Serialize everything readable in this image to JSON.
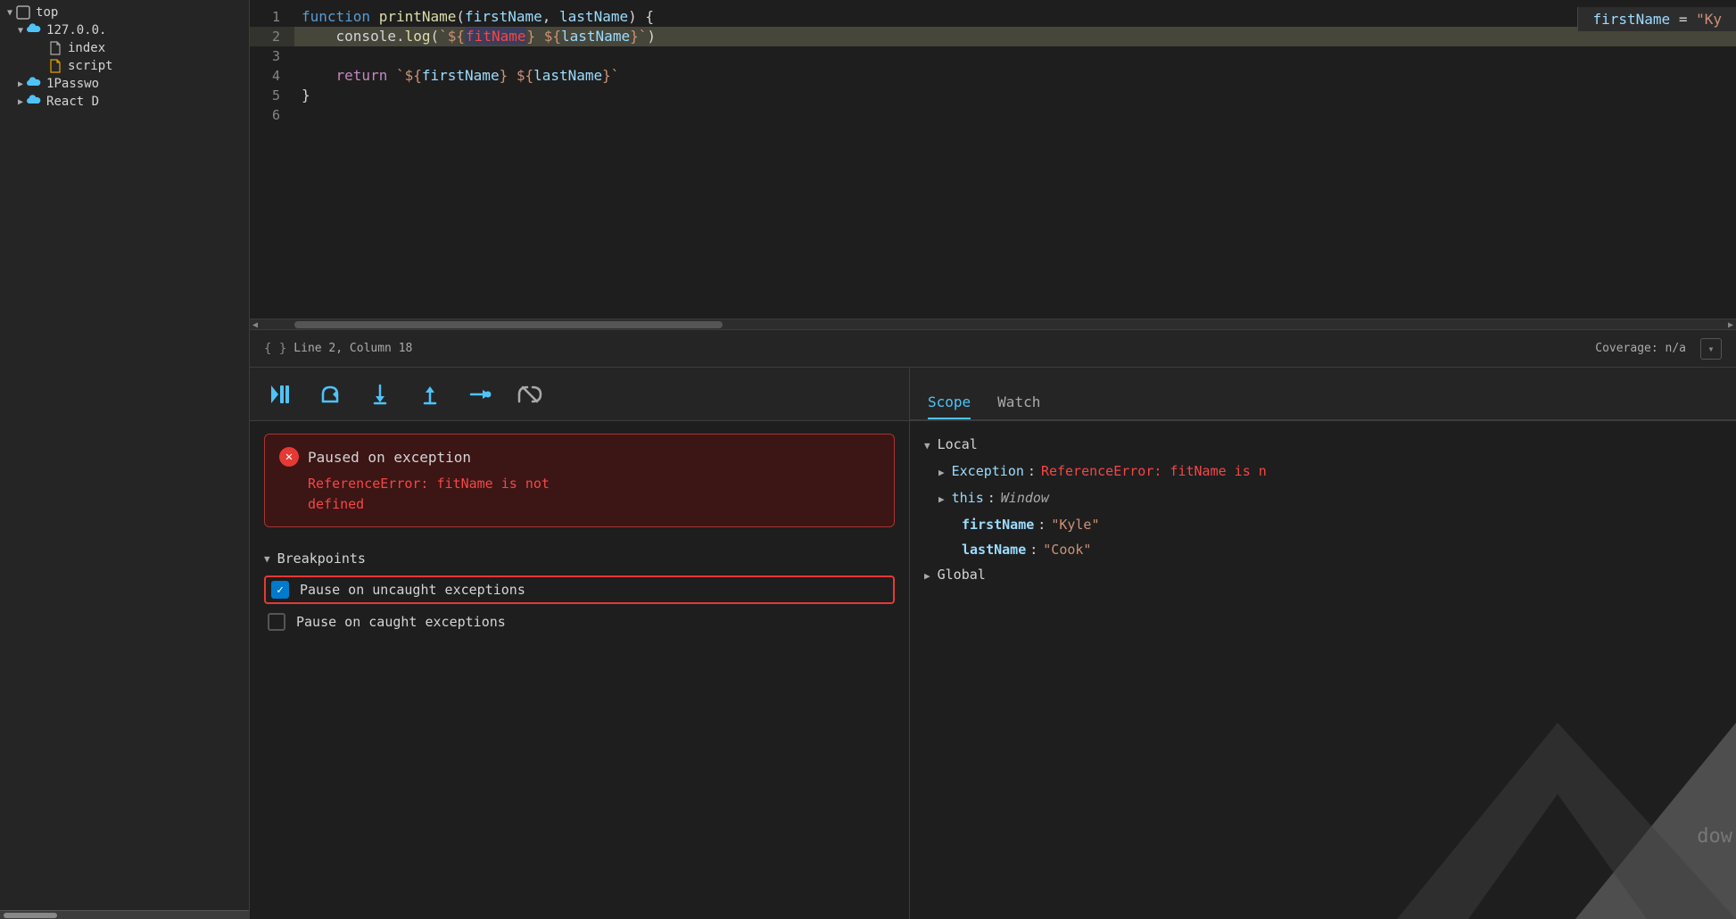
{
  "sidebar": {
    "items": [
      {
        "id": "top",
        "label": "top",
        "indent": 0,
        "arrow": "▼",
        "icon": "frame"
      },
      {
        "id": "127",
        "label": "127.0.0.",
        "indent": 1,
        "arrow": "▼",
        "icon": "cloud"
      },
      {
        "id": "index",
        "label": "index",
        "indent": 2,
        "arrow": "",
        "icon": "file"
      },
      {
        "id": "script",
        "label": "script",
        "indent": 2,
        "arrow": "",
        "icon": "file-orange"
      },
      {
        "id": "1password",
        "label": "1Passwo",
        "indent": 1,
        "arrow": "▶",
        "icon": "cloud"
      },
      {
        "id": "react",
        "label": "React D",
        "indent": 1,
        "arrow": "▶",
        "icon": "cloud"
      }
    ]
  },
  "editor": {
    "lines": [
      {
        "num": 1,
        "content": "function printName(firstName, lastName) {",
        "highlighted": false
      },
      {
        "num": 2,
        "content": "    console.log(`${fitName} ${lastName}`)",
        "highlighted": true
      },
      {
        "num": 3,
        "content": "",
        "highlighted": false
      },
      {
        "num": 4,
        "content": "    return `${firstName} ${lastName}`",
        "highlighted": false
      },
      {
        "num": 5,
        "content": "}",
        "highlighted": false
      },
      {
        "num": 6,
        "content": "",
        "highlighted": false
      }
    ],
    "right_preview": "firstName = \"Ky",
    "status": {
      "position": "Line 2, Column 18",
      "coverage": "Coverage: n/a"
    }
  },
  "toolbar": {
    "buttons": [
      {
        "id": "resume",
        "icon": "▶▌",
        "label": "Resume"
      },
      {
        "id": "step-over",
        "icon": "↺",
        "label": "Step over"
      },
      {
        "id": "step-into",
        "icon": "↓",
        "label": "Step into"
      },
      {
        "id": "step-out",
        "icon": "↑",
        "label": "Step out"
      },
      {
        "id": "step-next",
        "icon": "→•",
        "label": "Step"
      },
      {
        "id": "deactivate",
        "icon": "⇢",
        "label": "Deactivate"
      }
    ]
  },
  "exception": {
    "title": "Paused on exception",
    "message": "ReferenceError: fitName is not\ndefined"
  },
  "breakpoints": {
    "title": "Breakpoints",
    "items": [
      {
        "id": "uncaught",
        "checked": true,
        "label": "Pause on uncaught exceptions",
        "highlighted": true
      },
      {
        "id": "caught",
        "checked": false,
        "label": "Pause on caught exceptions",
        "highlighted": false
      }
    ]
  },
  "scope": {
    "tabs": [
      {
        "id": "scope",
        "label": "Scope",
        "active": true
      },
      {
        "id": "watch",
        "label": "Watch",
        "active": false
      }
    ],
    "tree": [
      {
        "id": "local",
        "label": "Local",
        "arrow": "▼",
        "indent": 0,
        "key": "",
        "colon": "",
        "value": ""
      },
      {
        "id": "exception-item",
        "label": "Exception: ReferenceError: fitName is n",
        "arrow": "▶",
        "indent": 1,
        "key": "Exception",
        "colon": ":",
        "value": "ReferenceError: fitName is n",
        "val_type": "err"
      },
      {
        "id": "this-item",
        "label": "this: Window",
        "arrow": "▶",
        "indent": 1,
        "key": "this",
        "colon": ":",
        "value": "Window",
        "val_type": "obj"
      },
      {
        "id": "firstname-item",
        "label": "firstName: \"Kyle\"",
        "arrow": "",
        "indent": 1,
        "key": "firstName",
        "colon": ":",
        "value": "\"Kyle\"",
        "val_type": "str"
      },
      {
        "id": "lastname-item",
        "label": "lastName: \"Cook\"",
        "arrow": "",
        "indent": 1,
        "key": "lastName",
        "colon": ":",
        "value": "\"Cook\"",
        "val_type": "str"
      },
      {
        "id": "global",
        "label": "Global",
        "arrow": "▶",
        "indent": 0,
        "key": "",
        "colon": "",
        "value": ""
      }
    ]
  }
}
